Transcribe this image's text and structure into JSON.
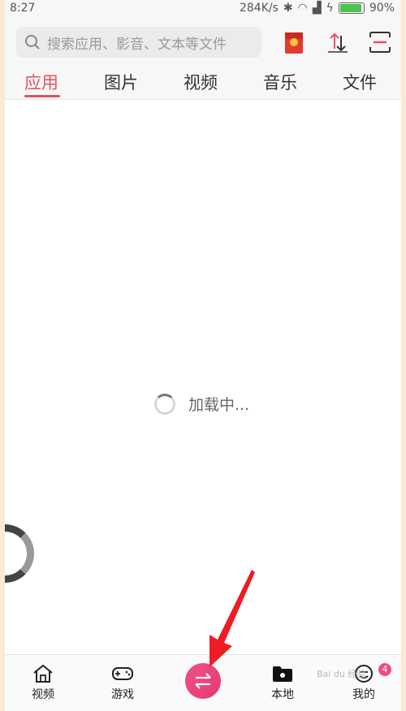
{
  "status_bar": {
    "time": "8:27",
    "speed": "284K/s",
    "battery": "90%",
    "battery_level": 0.9
  },
  "search": {
    "placeholder": "搜索应用、影音、文本等文件"
  },
  "header_icons": [
    "red-envelope-icon",
    "transfer-sort-icon",
    "scan-icon"
  ],
  "tabs": [
    {
      "label": "应用",
      "active": true
    },
    {
      "label": "图片",
      "active": false
    },
    {
      "label": "视频",
      "active": false
    },
    {
      "label": "音乐",
      "active": false
    },
    {
      "label": "文件",
      "active": false
    }
  ],
  "loading": {
    "text": "加载中..."
  },
  "bottom_nav": {
    "items": [
      {
        "label": "视频",
        "icon": "home-icon"
      },
      {
        "label": "游戏",
        "icon": "gamepad-icon"
      },
      {
        "label": "",
        "icon": "transfer-icon"
      },
      {
        "label": "本地",
        "icon": "folder-icon"
      },
      {
        "label": "我的",
        "icon": "profile-icon"
      }
    ],
    "badge_count": "4"
  },
  "colors": {
    "accent": "#e8505b",
    "center_button": "#ec4478",
    "annotation_arrow": "#ee1c24"
  }
}
